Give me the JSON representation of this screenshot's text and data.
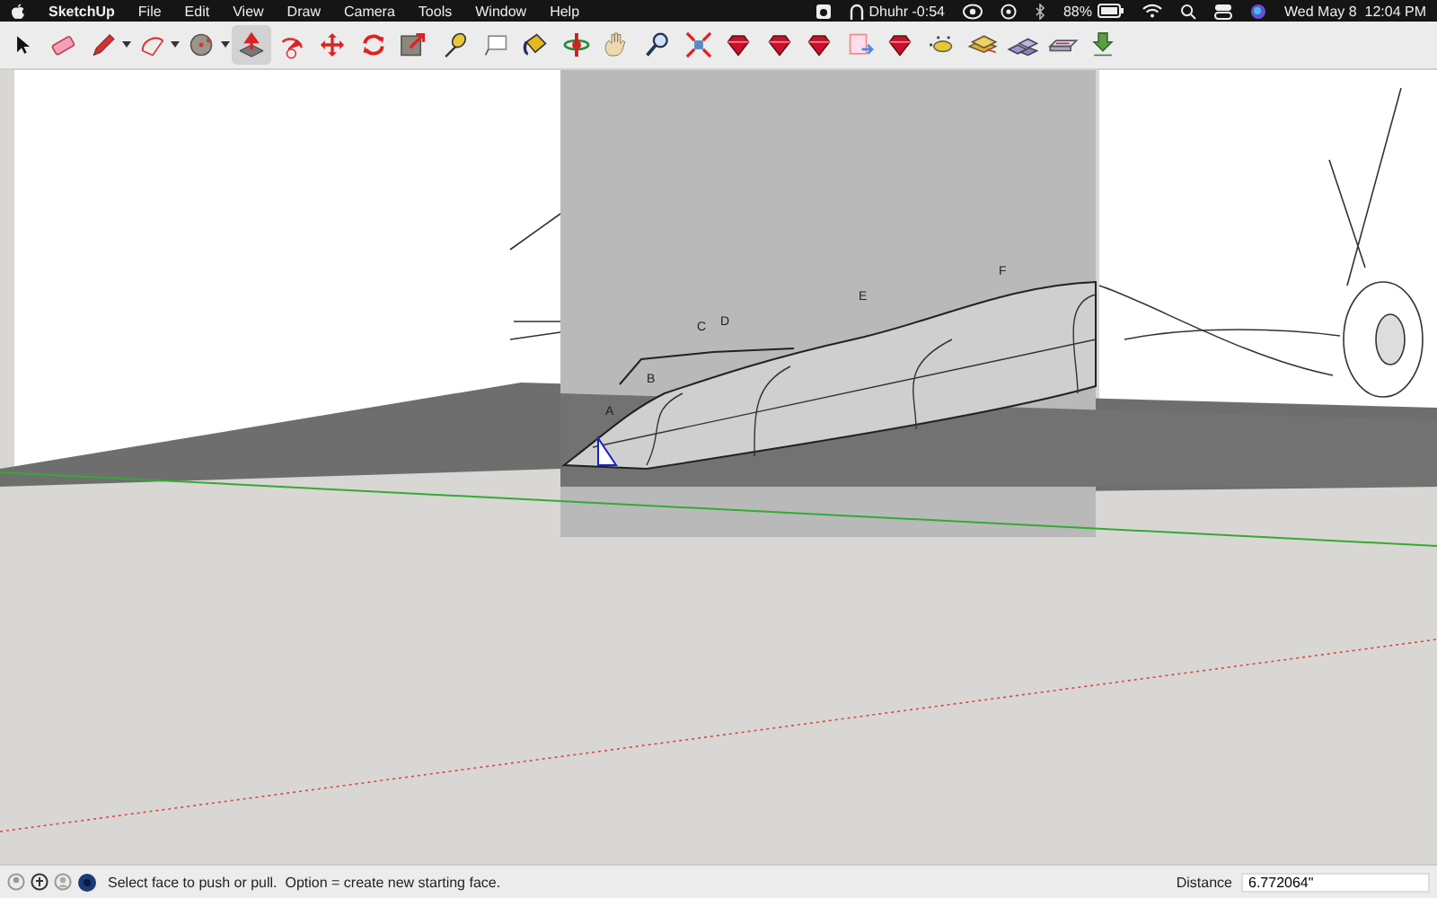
{
  "menu_bar": {
    "app": "SketchUp",
    "menus": [
      "File",
      "Edit",
      "View",
      "Draw",
      "Camera",
      "Tools",
      "Window",
      "Help"
    ],
    "prayer": "Dhuhr -0:54",
    "battery": "88%",
    "clock": "Wed May 8  12:04 PM"
  },
  "toolbar": {
    "tools": [
      {
        "kind": "pointer",
        "selected": false,
        "dropdown": false
      },
      {
        "kind": "eraser",
        "selected": false,
        "dropdown": false
      },
      {
        "kind": "pencil",
        "selected": false,
        "dropdown": true
      },
      {
        "kind": "arc",
        "selected": false,
        "dropdown": true
      },
      {
        "kind": "circle",
        "selected": false,
        "dropdown": true
      },
      {
        "kind": "pushpull",
        "selected": true,
        "dropdown": false
      },
      {
        "kind": "swirl",
        "selected": false,
        "dropdown": false
      },
      {
        "kind": "move",
        "selected": false,
        "dropdown": false
      },
      {
        "kind": "rotate",
        "selected": false,
        "dropdown": false
      },
      {
        "kind": "scale",
        "selected": false,
        "dropdown": false
      },
      {
        "kind": "tape",
        "selected": false,
        "dropdown": false
      },
      {
        "kind": "text",
        "selected": false,
        "dropdown": false
      },
      {
        "kind": "bucket",
        "selected": false,
        "dropdown": false
      },
      {
        "kind": "orbit",
        "selected": false,
        "dropdown": false
      },
      {
        "kind": "hand",
        "selected": false,
        "dropdown": false
      },
      {
        "kind": "zoom",
        "selected": false,
        "dropdown": false
      },
      {
        "kind": "extents",
        "selected": false,
        "dropdown": false
      },
      {
        "kind": "gem",
        "selected": false,
        "dropdown": false
      },
      {
        "kind": "gem",
        "selected": false,
        "dropdown": false
      },
      {
        "kind": "gem",
        "selected": false,
        "dropdown": false
      },
      {
        "kind": "document",
        "selected": false,
        "dropdown": false
      },
      {
        "kind": "gem",
        "selected": false,
        "dropdown": false
      },
      {
        "kind": "bug",
        "selected": false,
        "dropdown": false
      },
      {
        "kind": "stack",
        "selected": false,
        "dropdown": false
      },
      {
        "kind": "blocks",
        "selected": false,
        "dropdown": false
      },
      {
        "kind": "tray",
        "selected": false,
        "dropdown": false
      },
      {
        "kind": "download",
        "selected": false,
        "dropdown": false
      }
    ]
  },
  "viewport": {
    "section_marks": [
      "A",
      "B",
      "C",
      "D",
      "E",
      "F"
    ]
  },
  "status_bar": {
    "message": "Select face to push or pull.  Option = create new starting face.",
    "measure_label": "Distance",
    "measure_value": "6.772064\""
  }
}
